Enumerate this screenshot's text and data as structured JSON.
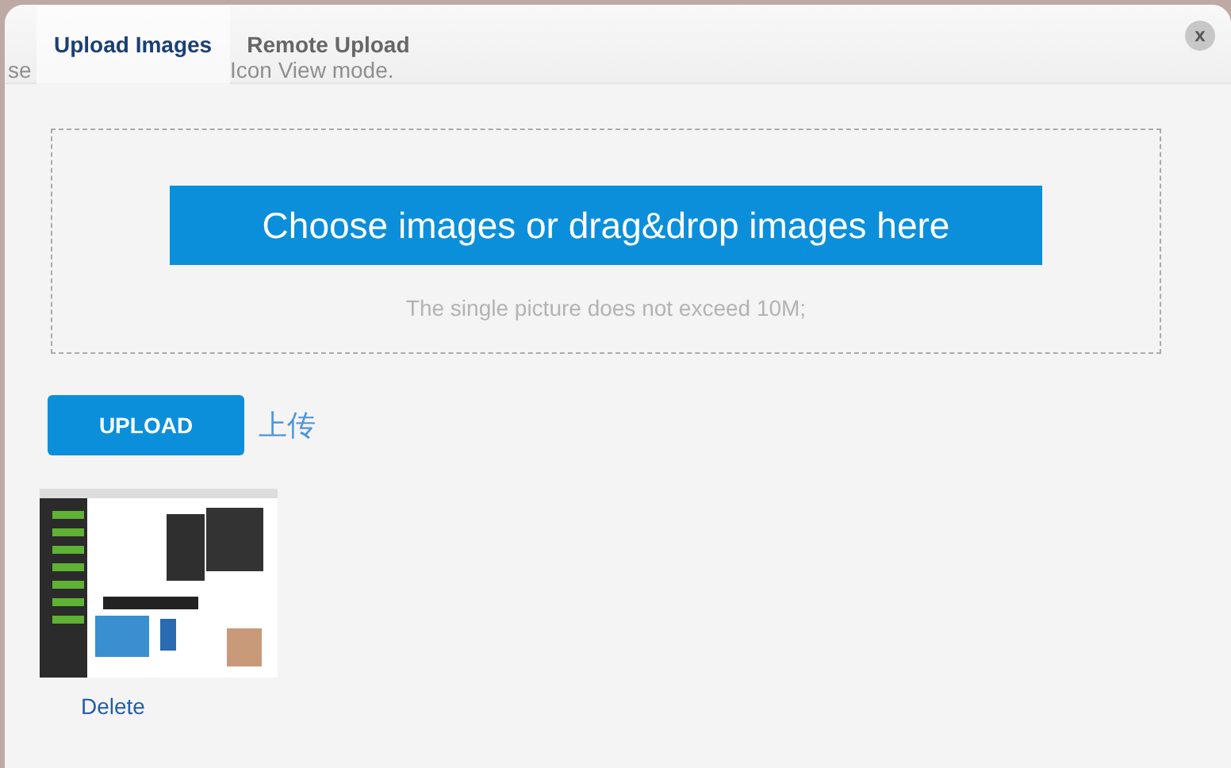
{
  "background_texts": [
    "se",
    "Icon View mode."
  ],
  "tabs": [
    {
      "label": "Upload Images",
      "selected": true
    },
    {
      "label": "Remote Upload",
      "selected": false
    }
  ],
  "close_button": {
    "label": "x"
  },
  "dropzone": {
    "button": "Choose images or drag&drop images here",
    "hint": "The single picture does not exceed 10M;"
  },
  "upload_button": "UPLOAD",
  "upload_label": "上传",
  "images": [
    {
      "kind": "picture",
      "action": "Delete"
    }
  ]
}
